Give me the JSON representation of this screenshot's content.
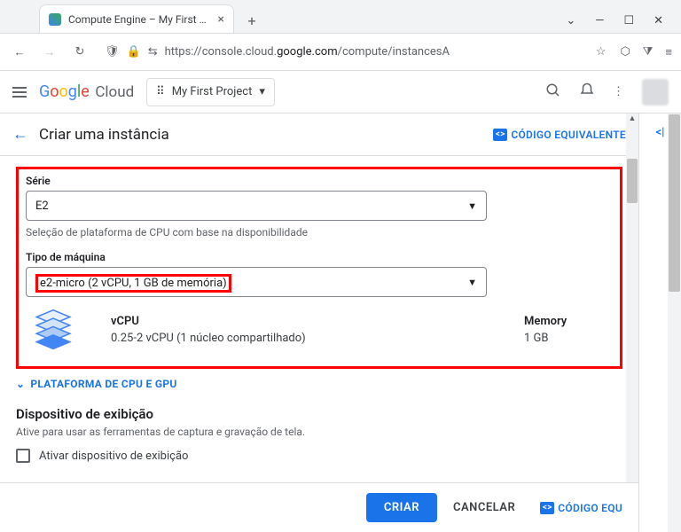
{
  "browser": {
    "tab_title": "Compute Engine – My First Proj",
    "url_prefix": "https://console.cloud.",
    "url_host": "google.com",
    "url_path": "/compute/instancesA"
  },
  "cloud_header": {
    "logo_cloud": "Cloud",
    "project_name": "My First Project"
  },
  "page": {
    "title": "Criar uma instância",
    "code_equiv_label": "CÓDIGO EQUIVALENTE"
  },
  "series": {
    "label": "Série",
    "value": "E2",
    "hint": "Seleção de plataforma de CPU com base na disponibilidade"
  },
  "machine_type": {
    "label": "Tipo de máquina",
    "value": "e2-micro (2 vCPU, 1 GB de memória)",
    "vcpu_head": "vCPU",
    "vcpu_val": "0.25-2 vCPU (1 núcleo compartilhado)",
    "mem_head": "Memory",
    "mem_val": "1 GB"
  },
  "platform_link": "PLATAFORMA DE CPU E GPU",
  "display": {
    "title": "Dispositivo de exibição",
    "desc": "Ative para usar as ferramentas de captura e gravação de tela.",
    "checkbox_label": "Ativar dispositivo de exibição"
  },
  "footer": {
    "create": "CRIAR",
    "cancel": "CANCELAR",
    "code": "CÓDIGO EQU"
  }
}
